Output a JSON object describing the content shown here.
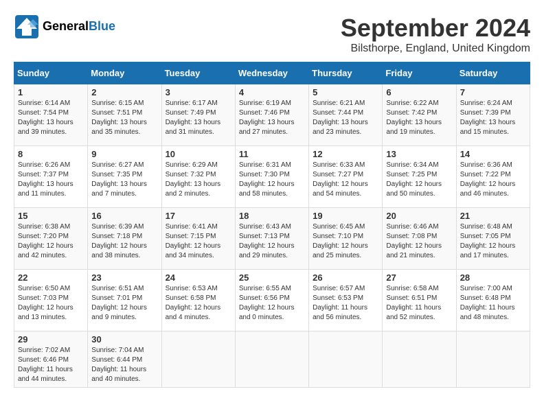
{
  "header": {
    "logo_general": "General",
    "logo_blue": "Blue",
    "title": "September 2024",
    "location": "Bilsthorpe, England, United Kingdom"
  },
  "weekdays": [
    "Sunday",
    "Monday",
    "Tuesday",
    "Wednesday",
    "Thursday",
    "Friday",
    "Saturday"
  ],
  "weeks": [
    [
      {
        "day": "1",
        "sunrise": "6:14 AM",
        "sunset": "7:54 PM",
        "daylight": "13 hours and 39 minutes."
      },
      {
        "day": "2",
        "sunrise": "6:15 AM",
        "sunset": "7:51 PM",
        "daylight": "13 hours and 35 minutes."
      },
      {
        "day": "3",
        "sunrise": "6:17 AM",
        "sunset": "7:49 PM",
        "daylight": "13 hours and 31 minutes."
      },
      {
        "day": "4",
        "sunrise": "6:19 AM",
        "sunset": "7:46 PM",
        "daylight": "13 hours and 27 minutes."
      },
      {
        "day": "5",
        "sunrise": "6:21 AM",
        "sunset": "7:44 PM",
        "daylight": "13 hours and 23 minutes."
      },
      {
        "day": "6",
        "sunrise": "6:22 AM",
        "sunset": "7:42 PM",
        "daylight": "13 hours and 19 minutes."
      },
      {
        "day": "7",
        "sunrise": "6:24 AM",
        "sunset": "7:39 PM",
        "daylight": "13 hours and 15 minutes."
      }
    ],
    [
      {
        "day": "8",
        "sunrise": "6:26 AM",
        "sunset": "7:37 PM",
        "daylight": "13 hours and 11 minutes."
      },
      {
        "day": "9",
        "sunrise": "6:27 AM",
        "sunset": "7:35 PM",
        "daylight": "13 hours and 7 minutes."
      },
      {
        "day": "10",
        "sunrise": "6:29 AM",
        "sunset": "7:32 PM",
        "daylight": "13 hours and 2 minutes."
      },
      {
        "day": "11",
        "sunrise": "6:31 AM",
        "sunset": "7:30 PM",
        "daylight": "12 hours and 58 minutes."
      },
      {
        "day": "12",
        "sunrise": "6:33 AM",
        "sunset": "7:27 PM",
        "daylight": "12 hours and 54 minutes."
      },
      {
        "day": "13",
        "sunrise": "6:34 AM",
        "sunset": "7:25 PM",
        "daylight": "12 hours and 50 minutes."
      },
      {
        "day": "14",
        "sunrise": "6:36 AM",
        "sunset": "7:22 PM",
        "daylight": "12 hours and 46 minutes."
      }
    ],
    [
      {
        "day": "15",
        "sunrise": "6:38 AM",
        "sunset": "7:20 PM",
        "daylight": "12 hours and 42 minutes."
      },
      {
        "day": "16",
        "sunrise": "6:39 AM",
        "sunset": "7:18 PM",
        "daylight": "12 hours and 38 minutes."
      },
      {
        "day": "17",
        "sunrise": "6:41 AM",
        "sunset": "7:15 PM",
        "daylight": "12 hours and 34 minutes."
      },
      {
        "day": "18",
        "sunrise": "6:43 AM",
        "sunset": "7:13 PM",
        "daylight": "12 hours and 29 minutes."
      },
      {
        "day": "19",
        "sunrise": "6:45 AM",
        "sunset": "7:10 PM",
        "daylight": "12 hours and 25 minutes."
      },
      {
        "day": "20",
        "sunrise": "6:46 AM",
        "sunset": "7:08 PM",
        "daylight": "12 hours and 21 minutes."
      },
      {
        "day": "21",
        "sunrise": "6:48 AM",
        "sunset": "7:05 PM",
        "daylight": "12 hours and 17 minutes."
      }
    ],
    [
      {
        "day": "22",
        "sunrise": "6:50 AM",
        "sunset": "7:03 PM",
        "daylight": "12 hours and 13 minutes."
      },
      {
        "day": "23",
        "sunrise": "6:51 AM",
        "sunset": "7:01 PM",
        "daylight": "12 hours and 9 minutes."
      },
      {
        "day": "24",
        "sunrise": "6:53 AM",
        "sunset": "6:58 PM",
        "daylight": "12 hours and 4 minutes."
      },
      {
        "day": "25",
        "sunrise": "6:55 AM",
        "sunset": "6:56 PM",
        "daylight": "12 hours and 0 minutes."
      },
      {
        "day": "26",
        "sunrise": "6:57 AM",
        "sunset": "6:53 PM",
        "daylight": "11 hours and 56 minutes."
      },
      {
        "day": "27",
        "sunrise": "6:58 AM",
        "sunset": "6:51 PM",
        "daylight": "11 hours and 52 minutes."
      },
      {
        "day": "28",
        "sunrise": "7:00 AM",
        "sunset": "6:48 PM",
        "daylight": "11 hours and 48 minutes."
      }
    ],
    [
      {
        "day": "29",
        "sunrise": "7:02 AM",
        "sunset": "6:46 PM",
        "daylight": "11 hours and 44 minutes."
      },
      {
        "day": "30",
        "sunrise": "7:04 AM",
        "sunset": "6:44 PM",
        "daylight": "11 hours and 40 minutes."
      },
      {
        "day": "",
        "sunrise": "",
        "sunset": "",
        "daylight": ""
      },
      {
        "day": "",
        "sunrise": "",
        "sunset": "",
        "daylight": ""
      },
      {
        "day": "",
        "sunrise": "",
        "sunset": "",
        "daylight": ""
      },
      {
        "day": "",
        "sunrise": "",
        "sunset": "",
        "daylight": ""
      },
      {
        "day": "",
        "sunrise": "",
        "sunset": "",
        "daylight": ""
      }
    ]
  ]
}
